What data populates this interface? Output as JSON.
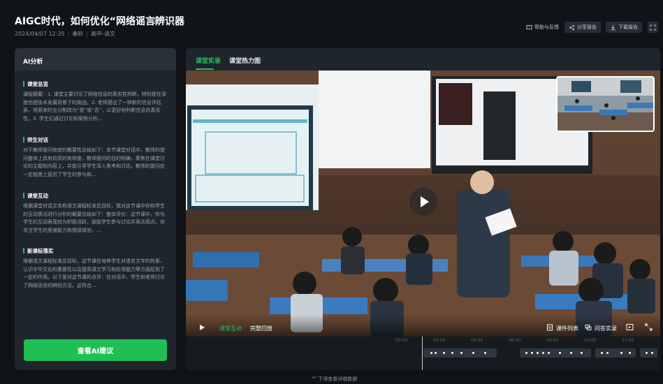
{
  "header": {
    "title": "AIGC时代，如何优化“网络谣言辨识器",
    "date": "2024/04/07 12:35",
    "teacher": "秦岭",
    "subject": "高中-语文",
    "help_label": "帮助与反馈",
    "share_label": "分享报告",
    "download_label": "下载报告"
  },
  "analysis": {
    "title": "AI分析",
    "sections": [
      {
        "heading": "课堂总览",
        "body": "课程摘要：1. 课堂主要讨论了网络信息的真实性判断，特别是在深度伪造技术发展背景下的挑战。2. 老师提出了一种新的信息评估表，将原来的五分制改为“是”或“否”，以更好地判断信息的真实性。3. 学生们通过讨论和案例分析..."
      },
      {
        "heading": "师生对话",
        "body": "对于教师提问效度的概要性总结如下：本节课堂对话中，教师的提问整体上具有较高的有效度。教师提问的目的明确，聚焦在课堂讨论的主题和内容上，并能引导学生深入思考和讨论。教师的提问在一定程度上促进了学生的参与和..."
      },
      {
        "heading": "课堂互动",
        "body": "根据课堂对话文本和语文课程标准总目标，我对这节课中你和学生的互动情况进行分析的概要总结如下：整体评价：这节课中，你与学生的互动表现较为积极活跃，鼓励学生参与讨论并表达观点。你关注学生的思维能力和情感体验，..."
      },
      {
        "heading": "新课标落实",
        "body": "根据语文课程标准总目标，这节课在培养学生对语言文字的热爱、认识中华文化的重要性以及提高语文学习和应用能力等方面起到了一定的作用。以下是对这节课的点评：在对话中，学生和老师讨论了网络谣言的辨别方法。这符合..."
      }
    ],
    "button_label": "查看AI建议"
  },
  "main": {
    "tabs": [
      "课堂实录",
      "课堂热力图"
    ],
    "video": {
      "segment_label": "课堂互动",
      "replay_label": "完整回放",
      "courseware_label": "课件列表",
      "qa_label": "问答实录"
    },
    "timeline_ticks": [
      "00:00",
      "02:00",
      "04:00",
      "06:00",
      "08:00",
      "10:00",
      "12:00"
    ],
    "slide": {
      "headline": "BREAK NEWS",
      "question": "问题2：应对谣言，你对网络谣言辨识器有什么改进建议？将来的方向与需求是什么？",
      "flow_boxes": [
        "真实信息",
        "发布者身份",
        "信源出处",
        "传播途径",
        "传播平台",
        "内容证据"
      ]
    }
  },
  "footer": {
    "label": "下滑查看详细数据"
  },
  "colors": {
    "accent": "#22c35e",
    "panel": "#1f252c",
    "background": "#0f1318"
  }
}
